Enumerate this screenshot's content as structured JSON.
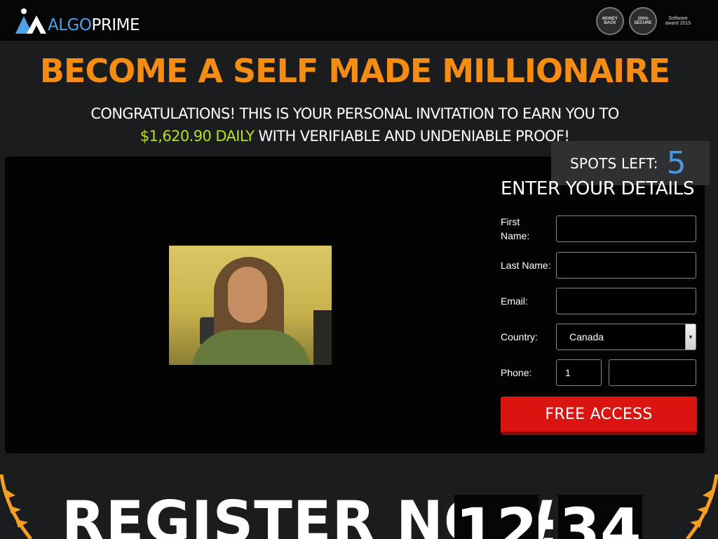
{
  "brand": {
    "name_part1": "ALGO",
    "name_part2": "PRIME"
  },
  "badges": [
    {
      "text": "MONEY BACK"
    },
    {
      "text": "100% SECURE"
    },
    {
      "text": "Software award 2015"
    }
  ],
  "headline": "BECOME A SELF MADE MILLIONAIRE",
  "subheadline": {
    "line1": "CONGRATULATIONS! THIS IS YOUR PERSONAL INVITATION TO EARN YOU TO",
    "amount": "$1,620.90 DAILY",
    "line2_rest": " WITH VERIFIABLE AND UNDENIABLE PROOF!"
  },
  "spots": {
    "label": "SPOTS LEFT:",
    "count": "5"
  },
  "form": {
    "title": "ENTER YOUR DETAILS",
    "first_name_label": "First Name:",
    "first_name_value": "",
    "last_name_label": "Last Name:",
    "last_name_value": "",
    "email_label": "Email:",
    "email_value": "",
    "country_label": "Country:",
    "country_value": "Canada",
    "phone_label": "Phone:",
    "phone_code_value": "1",
    "phone_number_value": "",
    "submit_label": "FREE ACCESS"
  },
  "register": {
    "label": "REGISTER NOW",
    "timer_minutes": "12",
    "timer_separator": ":",
    "timer_seconds": "34"
  },
  "colors": {
    "accent_orange": "#f58d14",
    "money_green": "#b4e023",
    "spots_blue": "#4a98e0",
    "cta_red": "#da1410"
  }
}
